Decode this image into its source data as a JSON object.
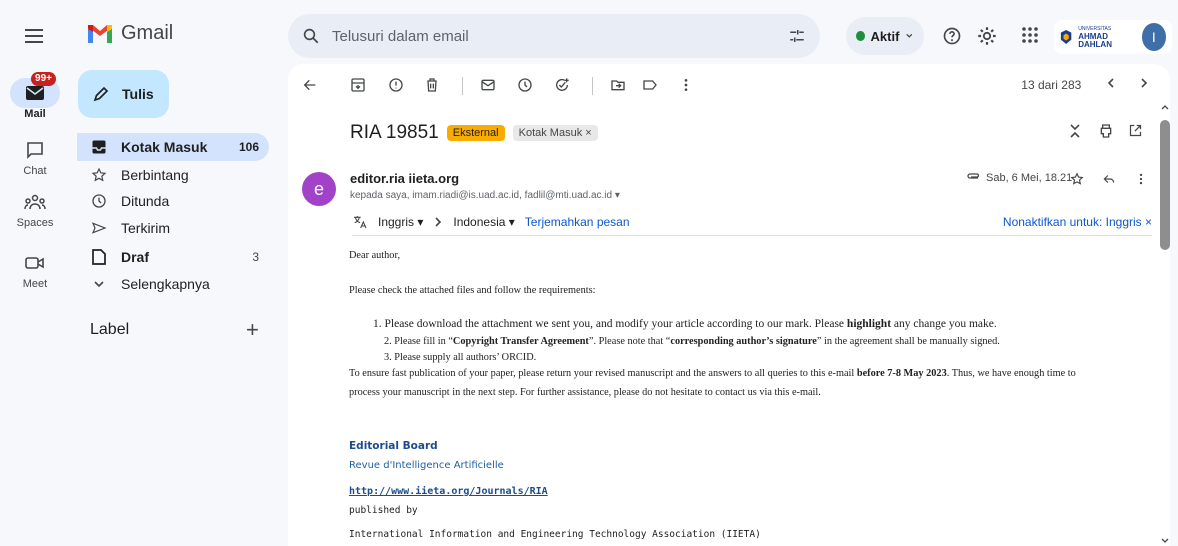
{
  "app": {
    "name": "Gmail"
  },
  "search": {
    "placeholder": "Telusuri dalam email"
  },
  "status": {
    "label": "Aktif"
  },
  "org": {
    "small": "UNIVERSITAS",
    "name": "AHMAD DAHLAN"
  },
  "user": {
    "initial": "I"
  },
  "rail": {
    "mail": {
      "label": "Mail",
      "badge": "99+"
    },
    "chat": {
      "label": "Chat"
    },
    "spaces": {
      "label": "Spaces"
    },
    "meet": {
      "label": "Meet"
    }
  },
  "compose": {
    "label": "Tulis"
  },
  "folders": [
    {
      "label": "Kotak Masuk",
      "count": "106"
    },
    {
      "label": "Berbintang",
      "count": ""
    },
    {
      "label": "Ditunda",
      "count": ""
    },
    {
      "label": "Terkirim",
      "count": ""
    },
    {
      "label": "Draf",
      "count": "3"
    },
    {
      "label": "Selengkapnya",
      "count": ""
    }
  ],
  "labels": {
    "heading": "Label",
    "add": "+"
  },
  "pager": {
    "text": "13 dari 283"
  },
  "email": {
    "subject": "RIA 19851",
    "badge_external": "Eksternal",
    "badge_inbox": "Kotak Masuk ×",
    "sender_initial": "e",
    "sender": "editor.ria iieta.org",
    "recipients": "kepada saya, imam.riadi@is.uad.ac.id, fadlil@mti.uad.ac.id ▾",
    "date": "Sab, 6 Mei, 18.21",
    "translate": {
      "from": "Inggris ▾",
      "to": "Indonesia ▾",
      "link": "Terjemahkan pesan",
      "off": "Nonaktifkan untuk: Inggris ×"
    },
    "body": {
      "greeting": "Dear author,",
      "intro": "Please check the attached files and follow the requirements:",
      "item1_a": "1. Please download the attachment we sent you, and modify your article according to our mark. Please ",
      "item1_b": "highlight",
      "item1_c": " any change you make.",
      "item2_a": "2. Please fill in “",
      "item2_b": "Copyright Transfer Agreement",
      "item2_c": "”. Please note that “",
      "item2_d": "corresponding author’s signature",
      "item2_e": "” in the agreement shall be manually signed.",
      "item3": "3. Please supply all authors’ ORCID.",
      "closing1_a": "To ensure fast publication of your paper, please return your revised manuscript and the answers to all queries to this e-mail ",
      "closing1_b": "before 7-8 May 2023",
      "closing1_c": ". Thus, we have enough time to",
      "closing2": "process your manuscript in the next step. For further assistance, please do not hesitate to contact us via this e-mail."
    },
    "signature": {
      "board": "Editorial Board",
      "journal": "Revue d'Intelligence Artificielle",
      "url": "http://www.iieta.org/Journals/RIA",
      "published": "published by",
      "association": "International Information and Engineering Technology Association (IIETA)"
    }
  }
}
